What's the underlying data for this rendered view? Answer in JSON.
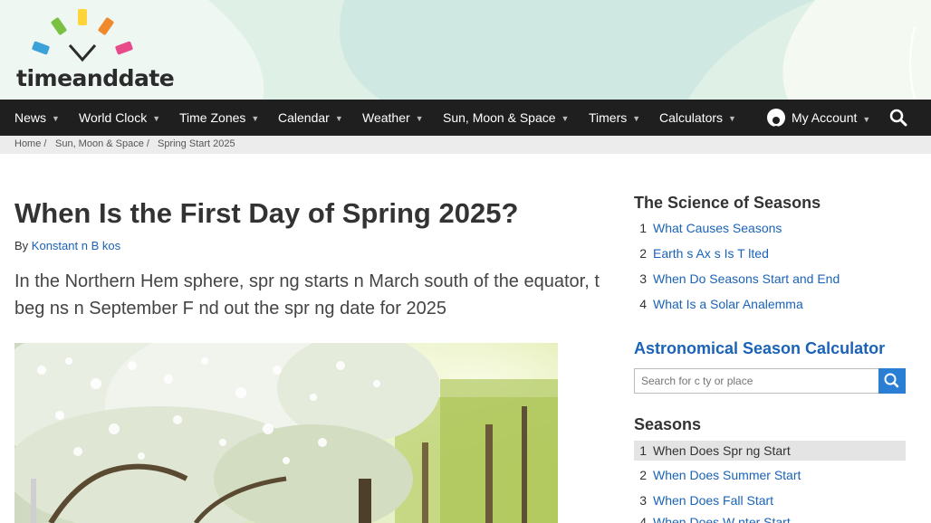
{
  "brand": {
    "logo_text": "timeanddate",
    "logo_colors": [
      "#e94b8a",
      "#f5a623",
      "#7ac143",
      "#3aa1d9",
      "#f0892b",
      "#ffd33a"
    ]
  },
  "nav": {
    "items": [
      {
        "label": "News"
      },
      {
        "label": "World Clock"
      },
      {
        "label": "Time Zones"
      },
      {
        "label": "Calendar"
      },
      {
        "label": "Weather"
      },
      {
        "label": "Sun, Moon & Space"
      },
      {
        "label": "Timers"
      },
      {
        "label": "Calculators"
      }
    ],
    "account_label": "My Account",
    "chevron_icon": "chevron-down-icon",
    "search_icon": "search-icon"
  },
  "breadcrumb": {
    "items": [
      "Home /",
      "Sun, Moon & Space /",
      "Spring Start 2025"
    ]
  },
  "article": {
    "title": "When Is the First Day of Spring 2025?",
    "byline_prefix": "By",
    "author": "Konstant n B kos",
    "lead": "In the Northern Hem sphere, spr ng starts  n March  south of the equator,  t beg ns  n September  F nd out the spr ng date for 2025"
  },
  "sidebar": {
    "science": {
      "heading": "The Science of Seasons",
      "items": [
        {
          "num": "1",
          "label": "What Causes Seasons"
        },
        {
          "num": "2",
          "label": "Earth s Ax s Is T lted"
        },
        {
          "num": "3",
          "label": "When Do Seasons Start and End"
        },
        {
          "num": "4",
          "label": "What Is a Solar Analemma"
        }
      ]
    },
    "calculator": {
      "heading": "Astronomical Season Calculator",
      "placeholder": "Search for c ty or place"
    },
    "seasons": {
      "heading": "Seasons",
      "items": [
        {
          "num": "1",
          "label": "When Does Spr ng Start"
        },
        {
          "num": "2",
          "label": "When Does Summer Start"
        },
        {
          "num": "3",
          "label": "When Does Fall Start"
        },
        {
          "num": "4",
          "label": "When Does W nter Start"
        }
      ]
    }
  },
  "colors": {
    "nav_bg": "#1f1f1f",
    "link": "#1a63b8",
    "accent": "#2a7fd4"
  }
}
